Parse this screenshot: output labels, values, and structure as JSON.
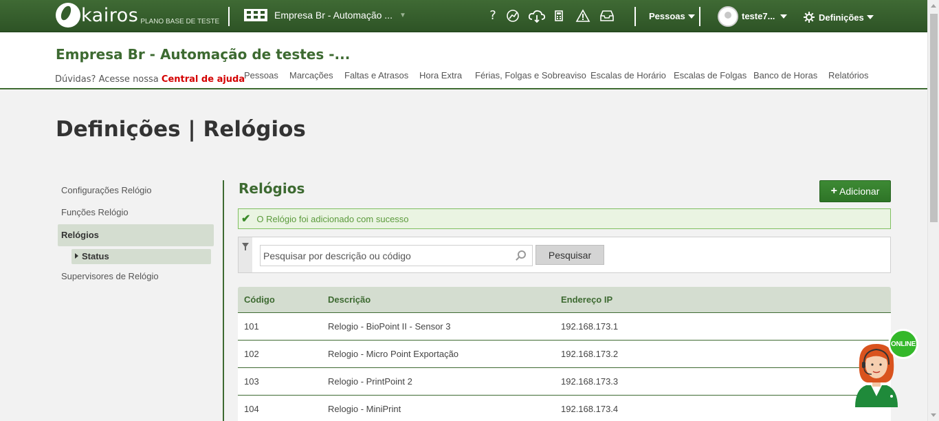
{
  "topbar": {
    "logo_text": "kairos",
    "logo_sub": "PLANO BASE DE TESTE",
    "company": "Empresa Br - Automação ...",
    "icons": [
      "help-icon",
      "feedback-icon",
      "cloud-sync-icon",
      "calculator-icon",
      "warning-icon",
      "inbox-icon"
    ],
    "help_glyph": "?",
    "people_menu": "Pessoas",
    "user_menu": "teste7...",
    "settings_menu": "Definições"
  },
  "header": {
    "company_title": "Empresa Br - Automação de testes -...",
    "help_prefix": "Dúvidas? Acesse nossa",
    "help_link": "Central de ajuda",
    "nav": [
      "Pessoas",
      "Marcações",
      "Faltas e Atrasos",
      "Hora Extra",
      "Férias, Folgas e Sobreaviso",
      "Escalas de Horário",
      "Escalas de Folgas",
      "Banco de Horas",
      "Relatórios"
    ]
  },
  "page_title": "Definições | Relógios",
  "sidebar": {
    "items": [
      "Configurações Relógio",
      "Funções Relógio",
      "Relógios",
      "Supervisores de Relógio"
    ],
    "sub_item": "Status"
  },
  "main": {
    "section_title": "Relógios",
    "add_button": "Adicionar",
    "alert": "O Relógio foi adicionado com sucesso",
    "search_placeholder": "Pesquisar por descrição ou código",
    "search_button": "Pesquisar",
    "table": {
      "columns": [
        "Código",
        "Descrição",
        "Endereço IP"
      ],
      "rows": [
        [
          "101",
          "Relogio - BioPoint II - Sensor 3",
          "192.168.173.1"
        ],
        [
          "102",
          "Relogio - Micro Point Exportação",
          "192.168.173.2"
        ],
        [
          "103",
          "Relogio - PrintPoint 2",
          "192.168.173.3"
        ],
        [
          "104",
          "Relogio - MiniPrint",
          "192.168.173.4"
        ]
      ]
    }
  },
  "chat_widget": {
    "status": "ONLINE"
  },
  "colors": {
    "brand_green": "#3d6a31",
    "header_green": "#2e5426",
    "online_green": "#34b82a",
    "help_red": "#d40000"
  }
}
